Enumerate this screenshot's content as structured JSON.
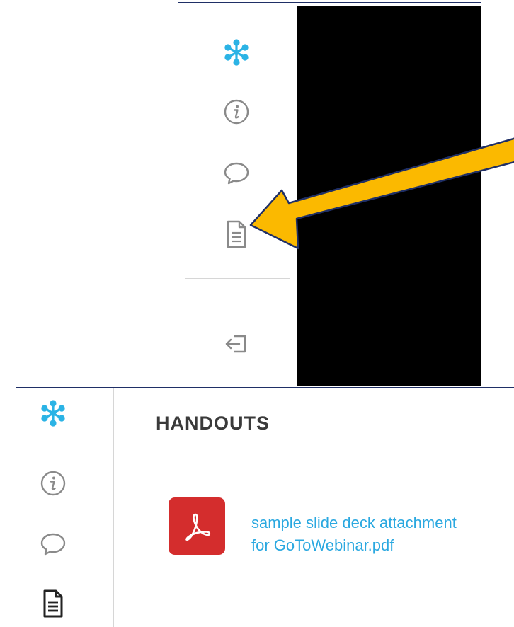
{
  "colors": {
    "accent": "#2bb3e5",
    "icon_gray": "#8a8a8a",
    "icon_dark": "#222222",
    "pdf_red": "#d42d2d",
    "link_blue": "#2aa8e0",
    "frame_border": "#1f2f66",
    "arrow_fill": "#fbb900"
  },
  "top_rail": {
    "icons": [
      "asterisk-logo-icon",
      "info-icon",
      "chat-bubble-icon",
      "document-icon",
      "exit-icon"
    ]
  },
  "bottom_panel": {
    "rail_icons": [
      "asterisk-logo-icon",
      "info-icon",
      "chat-bubble-icon",
      "document-icon"
    ],
    "header_title": "HANDOUTS",
    "handout": {
      "icon": "pdf-file-icon",
      "line1": "sample slide deck attachment",
      "line2": "for GoToWebinar.pdf"
    }
  }
}
